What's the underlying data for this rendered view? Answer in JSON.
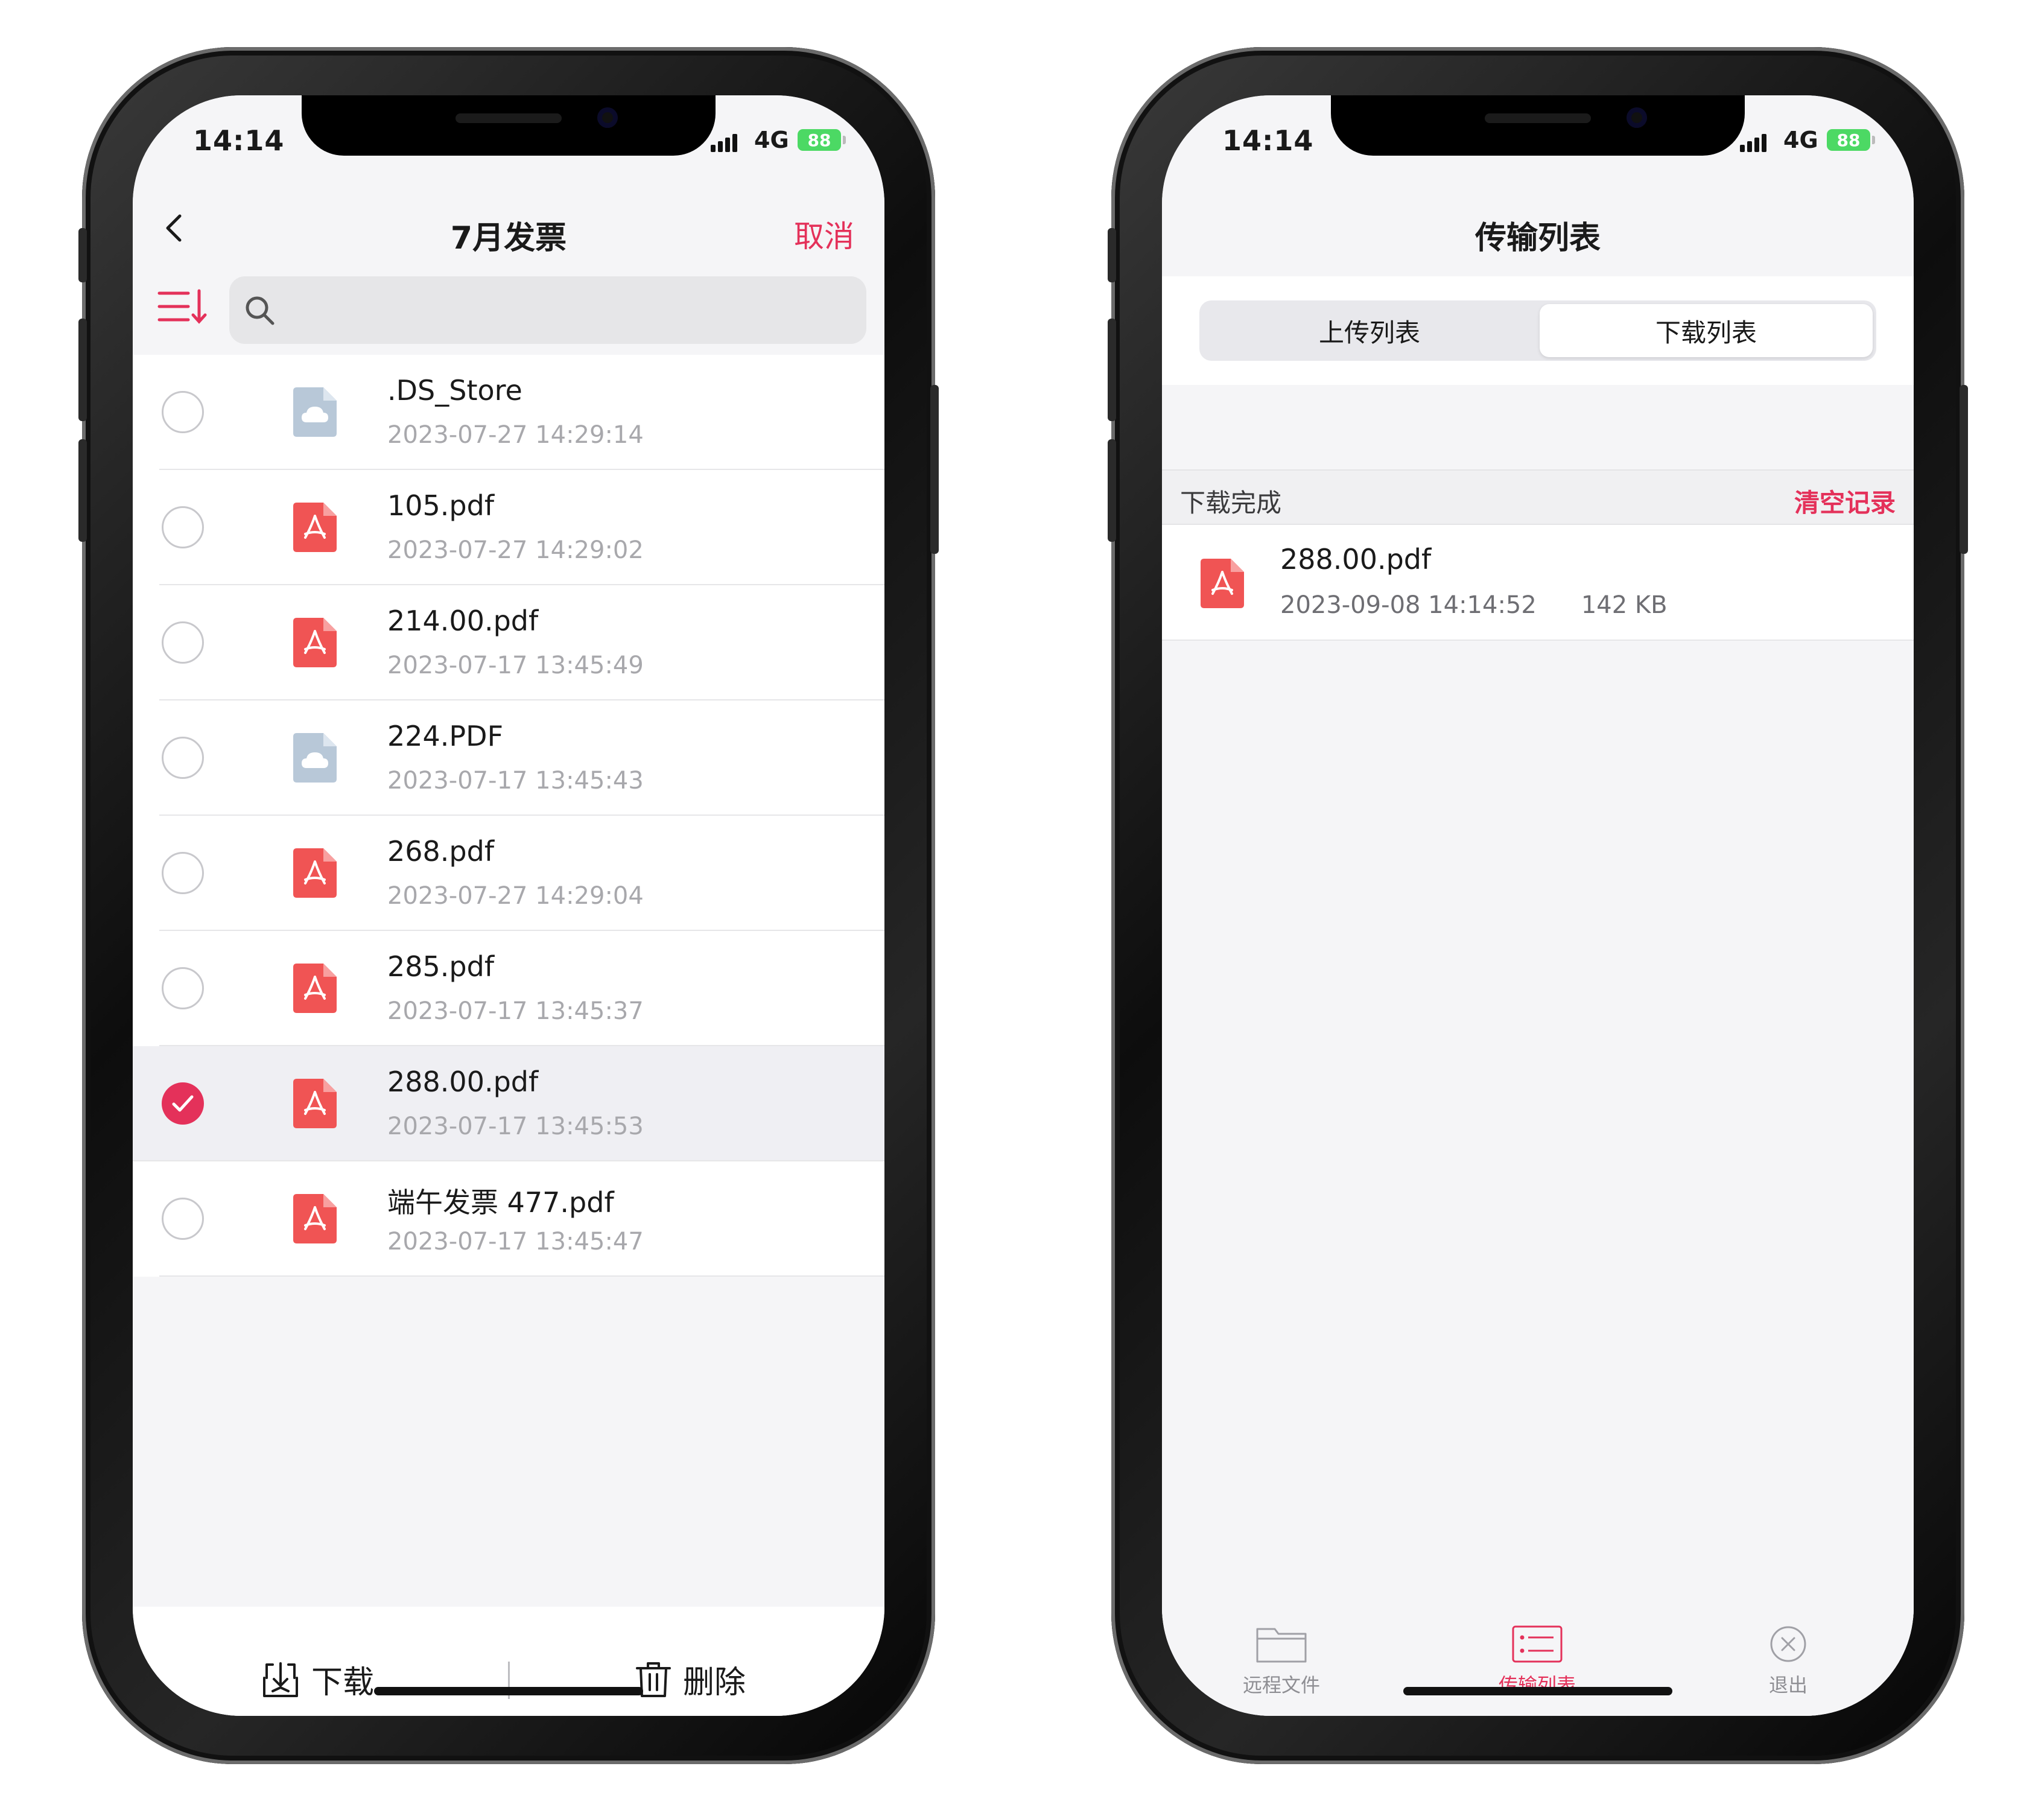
{
  "left_phone": {
    "status": {
      "time": "14:14",
      "network": "4G",
      "battery": "88"
    },
    "nav": {
      "title": "7月发票",
      "cancel": "取消"
    },
    "search": {
      "placeholder": ""
    },
    "files": [
      {
        "name": ".DS_Store",
        "date": "2023-07-27 14:29:14",
        "type": "cloud-file-icon",
        "selected": false
      },
      {
        "name": "105.pdf",
        "date": "2023-07-27 14:29:02",
        "type": "pdf-icon",
        "selected": false
      },
      {
        "name": "214.00.pdf",
        "date": "2023-07-17 13:45:49",
        "type": "pdf-icon",
        "selected": false
      },
      {
        "name": "224.PDF",
        "date": "2023-07-17 13:45:43",
        "type": "cloud-file-icon",
        "selected": false
      },
      {
        "name": "268.pdf",
        "date": "2023-07-27 14:29:04",
        "type": "pdf-icon",
        "selected": false
      },
      {
        "name": "285.pdf",
        "date": "2023-07-17 13:45:37",
        "type": "pdf-icon",
        "selected": false
      },
      {
        "name": "288.00.pdf",
        "date": "2023-07-17 13:45:53",
        "type": "pdf-icon",
        "selected": true
      },
      {
        "name": "端午发票 477.pdf",
        "date": "2023-07-17 13:45:47",
        "type": "pdf-icon",
        "selected": false
      }
    ],
    "actions": {
      "download": "下载",
      "delete": "删除"
    }
  },
  "right_phone": {
    "status": {
      "time": "14:14",
      "network": "4G",
      "battery": "88"
    },
    "nav": {
      "title": "传输列表"
    },
    "segments": {
      "upload": "上传列表",
      "download": "下载列表",
      "active": "download"
    },
    "section": {
      "label": "下载完成",
      "clear": "清空记录"
    },
    "download_item": {
      "name": "288.00.pdf",
      "date": "2023-09-08 14:14:52",
      "size": "142 KB"
    },
    "tabs": {
      "remote": "远程文件",
      "transfer": "传输列表",
      "logout": "退出",
      "active": "transfer"
    }
  },
  "colors": {
    "accent": "#e4315a",
    "pdf": "#f05454",
    "cloud_file": "#b8c8d8",
    "battery": "#4cd964"
  }
}
